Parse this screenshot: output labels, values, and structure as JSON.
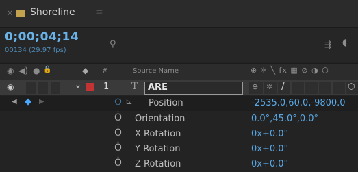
{
  "tab": {
    "close_glyph": "×",
    "comp_name": "Shoreline",
    "menu_glyph": "≡",
    "swatch_color": "#c2a24e"
  },
  "header": {
    "timecode": "0;00;04;14",
    "frame_info": "00134 (29.97 fps)",
    "search_glyph": "⚲",
    "flow_glyph": "⇶",
    "more_glyph": "◖"
  },
  "columns": {
    "video_glyph": "◉",
    "audio_glyph": "◀)",
    "solo_glyph": "●",
    "lock_glyph": "🔒",
    "label_glyph": "◆",
    "number_glyph": "#",
    "source_name": "Source Name",
    "switches_glyphs": "⊕ ✲ ╲ fx ▦ ⊘ ◑ ⬡"
  },
  "layer": {
    "eye_glyph": "◉",
    "twirl_glyph": "⌄",
    "label_color": "#c43333",
    "number": "1",
    "type_glyph": "T",
    "name": "ARE",
    "switch_shy": "⊕",
    "switch_collapse": "✲",
    "switch_quality": "/",
    "switch_3d": "⬡"
  },
  "properties": [
    {
      "name": "Position",
      "value": "-2535.0,60.0,-9800.0",
      "stopwatch": "⏱",
      "graph_glyph": "⊾"
    },
    {
      "name": "Orientation",
      "value": "0.0°,45.0°,0.0°",
      "stopwatch": "Ȯ"
    },
    {
      "name": "X Rotation",
      "value": "0x+0.0°",
      "stopwatch": "Ȯ"
    },
    {
      "name": "Y Rotation",
      "value": "0x+0.0°",
      "stopwatch": "Ȯ"
    },
    {
      "name": "Z Rotation",
      "value": "0x+0.0°",
      "stopwatch": "Ȯ"
    }
  ],
  "keyframe_nav": {
    "prev_glyph": "◀",
    "add_glyph": "◆",
    "next_glyph": "▶"
  },
  "colors": {
    "accent_blue": "#6ab3e8",
    "value_blue": "#5aa9e6",
    "keyframe_blue": "#4aa8ff"
  }
}
